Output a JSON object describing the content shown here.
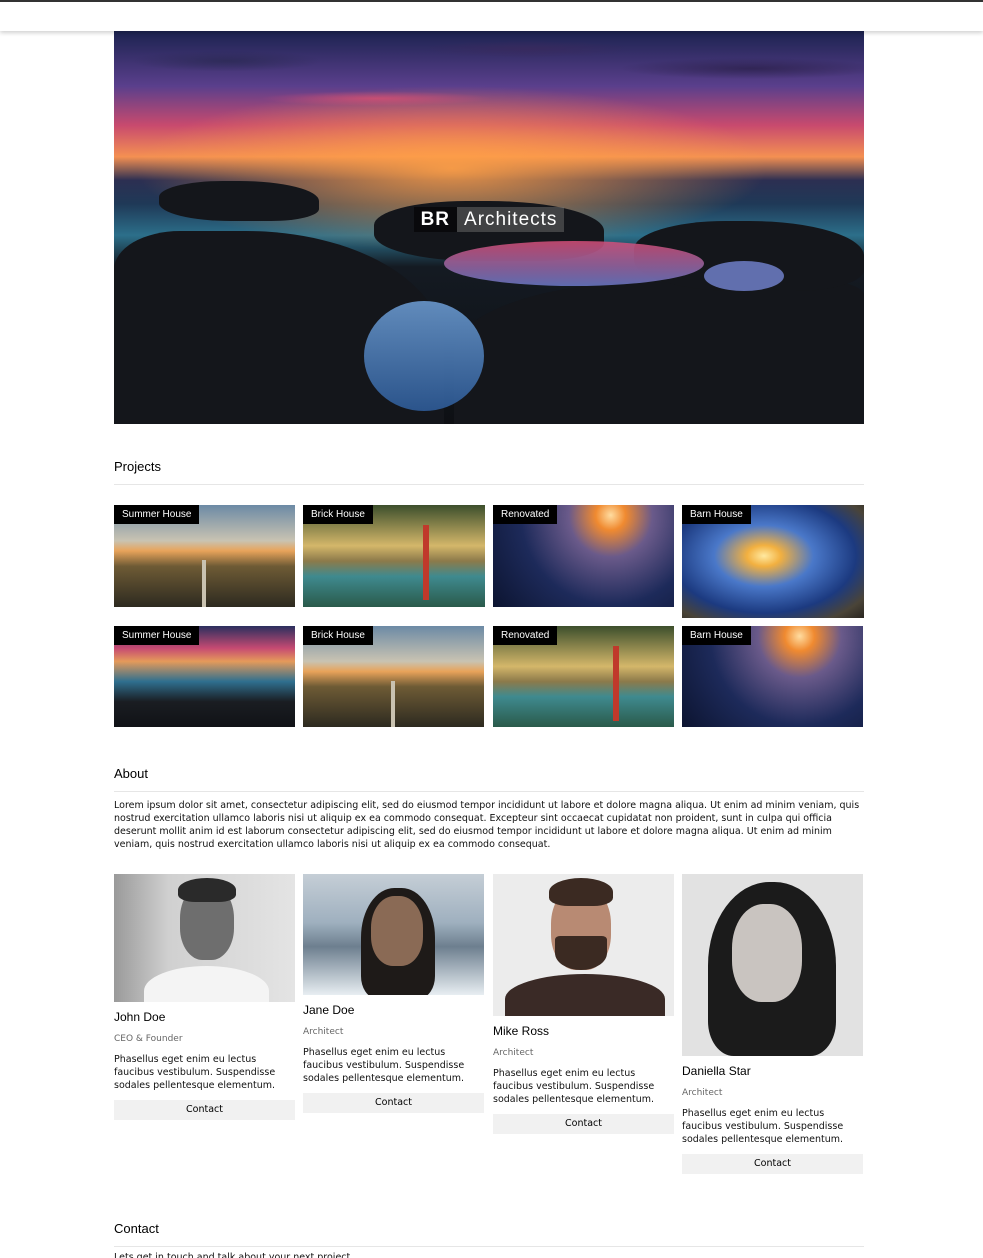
{
  "hero": {
    "brand_short": "BR",
    "brand_rest": "Architects"
  },
  "projects": {
    "title": "Projects",
    "tiles": [
      {
        "label": "Summer House"
      },
      {
        "label": "Brick House"
      },
      {
        "label": "Renovated"
      },
      {
        "label": "Barn House"
      },
      {
        "label": "Summer House"
      },
      {
        "label": "Brick House"
      },
      {
        "label": "Renovated"
      },
      {
        "label": "Barn House"
      }
    ]
  },
  "about": {
    "title": "About",
    "text": "Lorem ipsum dolor sit amet, consectetur adipiscing elit, sed do eiusmod tempor incididunt ut labore et dolore magna aliqua. Ut enim ad minim veniam, quis nostrud exercitation ullamco laboris nisi ut aliquip ex ea commodo consequat. Excepteur sint occaecat cupidatat non proident, sunt in culpa qui officia deserunt mollit anim id est laborum consectetur adipiscing elit, sed do eiusmod tempor incididunt ut labore et dolore magna aliqua. Ut enim ad minim veniam, quis nostrud exercitation ullamco laboris nisi ut aliquip ex ea commodo consequat."
  },
  "team": [
    {
      "name": "John Doe",
      "role": "CEO & Founder",
      "desc": "Phasellus eget enim eu lectus faucibus vestibulum. Suspendisse sodales pellentesque elementum.",
      "button": "Contact"
    },
    {
      "name": "Jane Doe",
      "role": "Architect",
      "desc": "Phasellus eget enim eu lectus faucibus vestibulum. Suspendisse sodales pellentesque elementum.",
      "button": "Contact"
    },
    {
      "name": "Mike Ross",
      "role": "Architect",
      "desc": "Phasellus eget enim eu lectus faucibus vestibulum. Suspendisse sodales pellentesque elementum.",
      "button": "Contact"
    },
    {
      "name": "Daniella Star",
      "role": "Architect",
      "desc": "Phasellus eget enim eu lectus faucibus vestibulum. Suspendisse sodales pellentesque elementum.",
      "button": "Contact"
    }
  ],
  "contact": {
    "title": "Contact",
    "subtitle": "Lets get in touch and talk about your next project."
  },
  "colors": {
    "label_bg": "#000000",
    "button_bg": "#f1f1f1",
    "divider": "#e6e6e6",
    "role_text": "#666666"
  }
}
